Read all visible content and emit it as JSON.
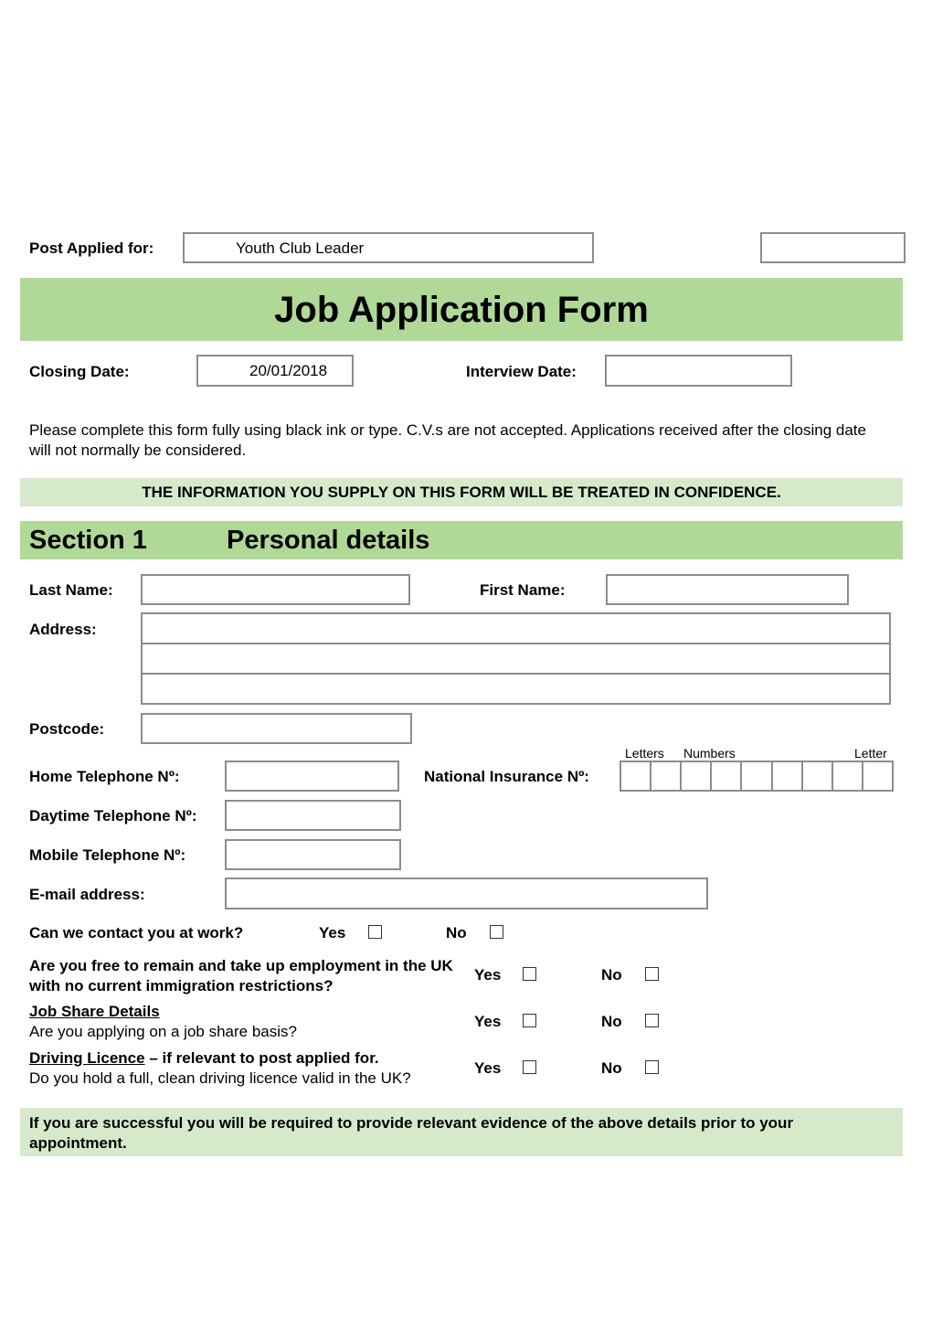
{
  "header": {
    "post_applied_label": "Post Applied for:",
    "post_applied_value": "Youth Club Leader",
    "reference_value": "",
    "title": "Job Application Form",
    "closing_date_label": "Closing Date:",
    "closing_date_value": "20/01/2018",
    "interview_date_label": "Interview Date:",
    "interview_date_value": ""
  },
  "instructions": "Please complete this form fully using black ink or type. C.V.s are not accepted. Applications received after the closing date will not normally be considered.",
  "confidence_notice": "THE INFORMATION YOU SUPPLY ON THIS FORM WILL BE TREATED IN CONFIDENCE.",
  "section1": {
    "number": "Section 1",
    "title": "Personal details",
    "fields": {
      "last_name": {
        "label": "Last Name:",
        "value": ""
      },
      "first_name": {
        "label": "First Name:",
        "value": ""
      },
      "address": {
        "label": "Address:",
        "lines": [
          "",
          "",
          ""
        ]
      },
      "postcode": {
        "label": "Postcode:",
        "value": ""
      },
      "home_tel": {
        "label": "Home Telephone Nº:",
        "value": ""
      },
      "ni_number": {
        "label": "National Insurance Nº:",
        "hint_letters": "Letters",
        "hint_numbers": "Numbers",
        "hint_letter": "Letter",
        "cells": [
          "",
          "",
          "",
          "",
          "",
          "",
          "",
          "",
          ""
        ]
      },
      "daytime_tel": {
        "label": "Daytime Telephone Nº:",
        "value": ""
      },
      "mobile_tel": {
        "label": "Mobile Telephone Nº:",
        "value": ""
      },
      "email": {
        "label": "E-mail address:",
        "value": ""
      }
    },
    "questions": [
      {
        "text": "Can we contact you at work?",
        "yes": "Yes",
        "no": "No",
        "yes_checked": false,
        "no_checked": false
      },
      {
        "text": "Are you free to remain and take up employment in the UK with no current immigration restrictions?",
        "yes": "Yes",
        "no": "No",
        "yes_checked": false,
        "no_checked": false
      },
      {
        "heading": "Job Share Details",
        "text": "Are you applying on a job share basis?",
        "yes": "Yes",
        "no": "No",
        "yes_checked": false,
        "no_checked": false
      },
      {
        "heading": "Driving Licence",
        "heading_suffix": " – if relevant to post applied for.",
        "text": "Do you hold a full, clean driving licence valid in the UK?",
        "yes": "Yes",
        "no": "No",
        "yes_checked": false,
        "no_checked": false
      }
    ],
    "evidence_notice": "If you are successful you will be required to provide relevant evidence of the above details prior to your appointment."
  },
  "colors": {
    "band_dark": "#b0d998",
    "band_light": "#d6eacb",
    "field_border": "#8c8c8c"
  }
}
